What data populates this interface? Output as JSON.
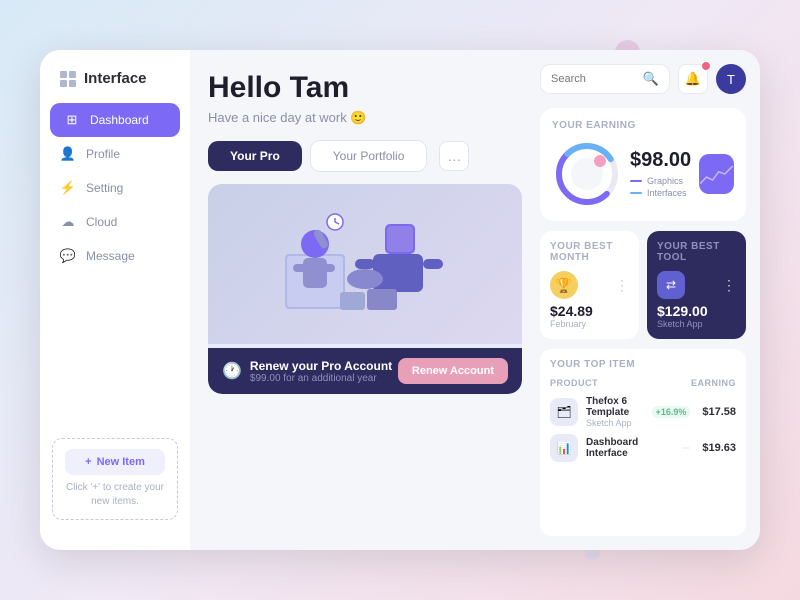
{
  "brand": {
    "title": "Interface"
  },
  "nav": {
    "items": [
      {
        "id": "dashboard",
        "label": "Dashboard",
        "icon": "⊞",
        "active": true
      },
      {
        "id": "profile",
        "label": "Profile",
        "icon": "👤",
        "active": false
      },
      {
        "id": "setting",
        "label": "Setting",
        "icon": "⚡",
        "active": false
      },
      {
        "id": "cloud",
        "label": "Cloud",
        "icon": "☁",
        "active": false
      },
      {
        "id": "message",
        "label": "Message",
        "icon": "💬",
        "active": false
      }
    ],
    "new_item_btn": "New Item",
    "new_item_hint": "Click '+' to create your new items."
  },
  "greeting": {
    "title": "Hello Tam",
    "subtitle": "Have a nice day at work 🙂"
  },
  "tabs": {
    "active": "Your Pro",
    "inactive": "Your Portfolio",
    "more": "…"
  },
  "promo": {
    "renew_title": "Renew your Pro Account",
    "renew_sub": "$99.00 for an additional year",
    "renew_btn": "Renew Account"
  },
  "header_right": {
    "search_placeholder": "Search"
  },
  "earning": {
    "label": "Your Earning",
    "amount": "$98.00",
    "legends": [
      {
        "color": "#7c6af5",
        "label": "Graphics"
      },
      {
        "color": "#6ab0f5",
        "label": "Interfaces"
      }
    ]
  },
  "best_month": {
    "label": "Your Best Month",
    "amount": "$24.89",
    "sub": "February"
  },
  "best_tool": {
    "label": "Your Best Tool",
    "amount": "$129.00",
    "sub": "Sketch App"
  },
  "top_items": {
    "label": "Your Top Item",
    "headers": [
      "Product",
      "Earning"
    ],
    "items": [
      {
        "name": "Thefox 6 Template",
        "store": "Sketch App",
        "badge": "+16.9%",
        "earning": "$17.58",
        "icon": "🗂"
      },
      {
        "name": "Dashboard Interface",
        "store": "",
        "badge": "",
        "earning": "$19.63",
        "icon": "📊"
      }
    ]
  }
}
